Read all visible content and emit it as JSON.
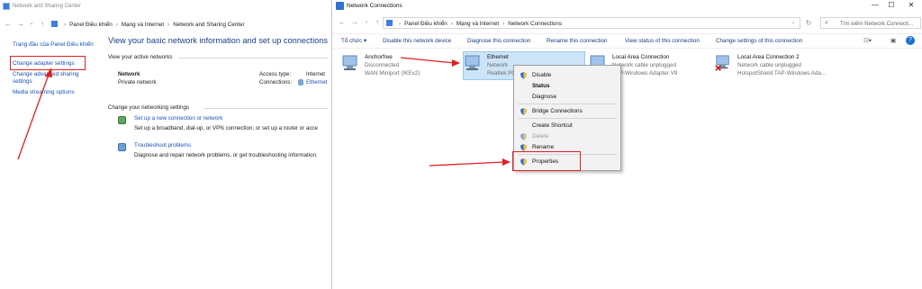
{
  "left": {
    "title": "Network and Sharing Center",
    "address": [
      "Panel Điều khiển",
      "Mạng và Internet",
      "Network and Sharing Center"
    ],
    "sidebar": {
      "home": "Trang đầu của Panel Điều khiển",
      "adapter": "Change adapter settings",
      "advanced_1": "Change advanced sharing",
      "advanced_2": "settings",
      "media": "Media streaming options"
    },
    "heading": "View your basic network information and set up connections",
    "active_label": "View your active networks",
    "network_name": "Network",
    "network_type": "Private network",
    "access_label": "Access type:",
    "access_value": "Internet",
    "conn_label": "Connections:",
    "conn_value": "Ethernet",
    "change_label": "Change your networking settings",
    "setup_link": "Set up a new connection or network",
    "setup_desc": "Set up a broadband, dial-up, or VPN connection; or set up a router or acce",
    "trouble_link": "Troubleshoot problems",
    "trouble_desc": "Diagnose and repair network problems, or get troubleshooting information."
  },
  "right": {
    "title": "Network Connections",
    "address": [
      "Panel Điều khiển",
      "Mạng và Internet",
      "Network Connections"
    ],
    "search_placeholder": "Tìm kiếm Network Connecti...",
    "toolbar": {
      "organize": "Tổ chức",
      "disable": "Disable this network device",
      "diagnose": "Diagnose this connection",
      "rename": "Rename this connection",
      "status": "View status of this connection",
      "change": "Change settings of this connection"
    },
    "adapters": [
      {
        "name": "Anchorfree",
        "status": "Disconnected",
        "device": "WAN Miniport (IKEv2)"
      },
      {
        "name": "Ethernet",
        "status": "Network",
        "device": "Realtek PC"
      },
      {
        "name": "Local Area Connection",
        "status": "Network cable unplugged",
        "device": "TAP-Windows Adapter V9"
      },
      {
        "name": "Local Area Connection 2",
        "status": "Network cable unplugged",
        "device": "HotspotShield TAP-Windows Ada..."
      }
    ],
    "menu": {
      "disable": "Disable",
      "status": "Status",
      "diagnose": "Diagnose",
      "bridge": "Bridge Connections",
      "shortcut": "Create Shortcut",
      "delete": "Delete",
      "rename": "Rename",
      "properties": "Properties"
    }
  },
  "colors": {
    "annotation": "#e02020",
    "link": "#1a52b3",
    "heading": "#1b3f8a",
    "selection": "#cce4f7"
  }
}
